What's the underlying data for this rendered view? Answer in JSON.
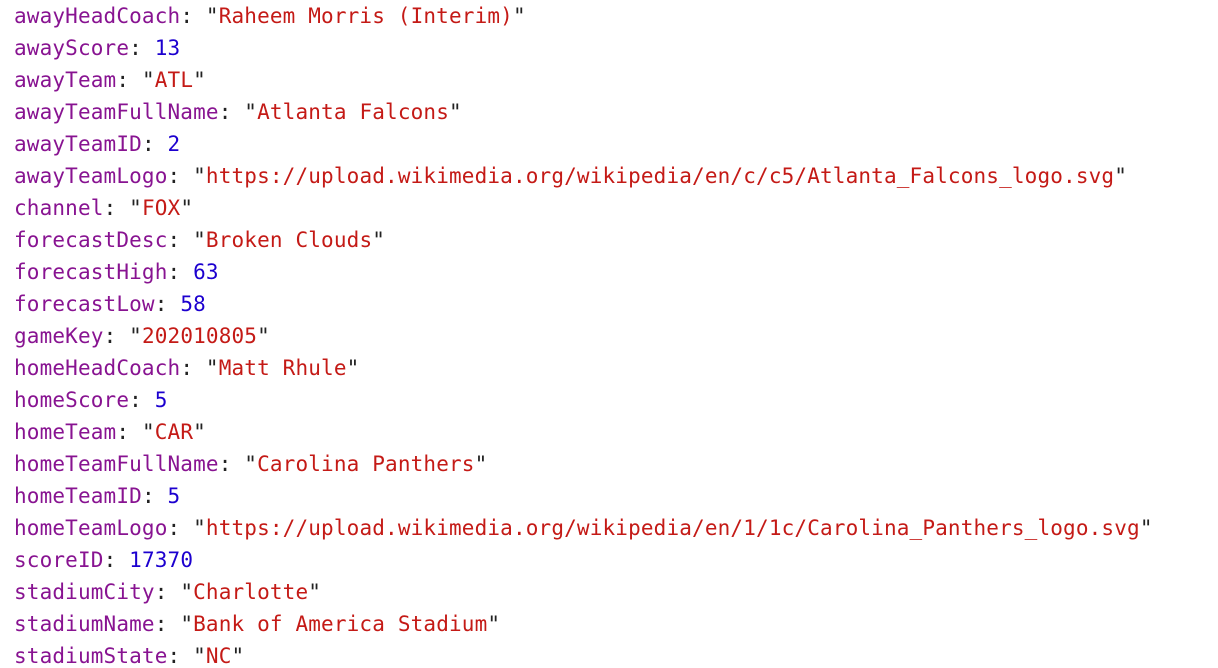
{
  "colors": {
    "key": "#881391",
    "string": "#c41a16",
    "number": "#1c00cf",
    "punctuation": "#222222"
  },
  "properties": [
    {
      "key": "awayHeadCoach",
      "type": "string",
      "value": "Raheem Morris (Interim)"
    },
    {
      "key": "awayScore",
      "type": "number",
      "value": "13"
    },
    {
      "key": "awayTeam",
      "type": "string",
      "value": "ATL"
    },
    {
      "key": "awayTeamFullName",
      "type": "string",
      "value": "Atlanta Falcons"
    },
    {
      "key": "awayTeamID",
      "type": "number",
      "value": "2"
    },
    {
      "key": "awayTeamLogo",
      "type": "string",
      "value": "https://upload.wikimedia.org/wikipedia/en/c/c5/Atlanta_Falcons_logo.svg"
    },
    {
      "key": "channel",
      "type": "string",
      "value": "FOX"
    },
    {
      "key": "forecastDesc",
      "type": "string",
      "value": "Broken Clouds"
    },
    {
      "key": "forecastHigh",
      "type": "number",
      "value": "63"
    },
    {
      "key": "forecastLow",
      "type": "number",
      "value": "58"
    },
    {
      "key": "gameKey",
      "type": "string",
      "value": "202010805"
    },
    {
      "key": "homeHeadCoach",
      "type": "string",
      "value": "Matt Rhule"
    },
    {
      "key": "homeScore",
      "type": "number",
      "value": "5"
    },
    {
      "key": "homeTeam",
      "type": "string",
      "value": "CAR"
    },
    {
      "key": "homeTeamFullName",
      "type": "string",
      "value": "Carolina Panthers"
    },
    {
      "key": "homeTeamID",
      "type": "number",
      "value": "5"
    },
    {
      "key": "homeTeamLogo",
      "type": "string",
      "value": "https://upload.wikimedia.org/wikipedia/en/1/1c/Carolina_Panthers_logo.svg"
    },
    {
      "key": "scoreID",
      "type": "number",
      "value": "17370"
    },
    {
      "key": "stadiumCity",
      "type": "string",
      "value": "Charlotte"
    },
    {
      "key": "stadiumName",
      "type": "string",
      "value": "Bank of America Stadium"
    },
    {
      "key": "stadiumState",
      "type": "string",
      "value": "NC"
    }
  ]
}
